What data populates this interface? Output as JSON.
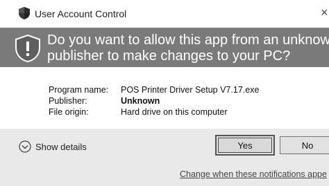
{
  "window": {
    "title": "User Account Control",
    "close_glyph": "×",
    "title_icon": "uac-shield-icon"
  },
  "banner": {
    "icon": "shield-warning-icon",
    "line1": "Do you want to allow this app from an unknown",
    "line2": "publisher to make changes to your PC?"
  },
  "info": {
    "program_name_label": "Program name:",
    "program_name_value": "POS Printer Driver Setup V7.17.exe",
    "publisher_label": "Publisher:",
    "publisher_value": "Unknown",
    "file_origin_label": "File origin:",
    "file_origin_value": "Hard drive on this computer"
  },
  "footer": {
    "details_label": "Show details",
    "details_icon": "chevron-down-circle-icon",
    "yes_label": "Yes",
    "no_label": "No",
    "change_link": "Change when these notifications appe"
  },
  "colors": {
    "banner_bg": "#7a7a7a",
    "footer_bg": "#e9e9e9"
  }
}
